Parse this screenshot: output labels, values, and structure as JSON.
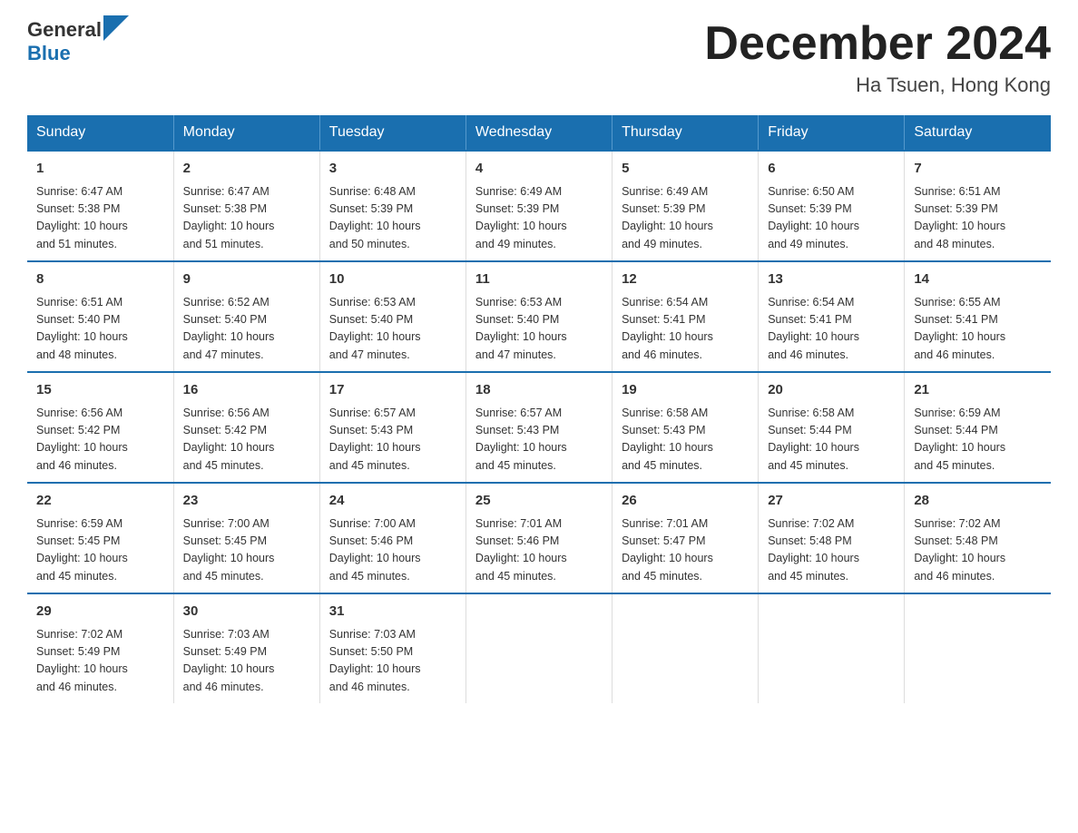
{
  "logo": {
    "general": "General",
    "blue": "Blue"
  },
  "title": "December 2024",
  "location": "Ha Tsuen, Hong Kong",
  "days_of_week": [
    "Sunday",
    "Monday",
    "Tuesday",
    "Wednesday",
    "Thursday",
    "Friday",
    "Saturday"
  ],
  "weeks": [
    [
      {
        "day": "1",
        "sunrise": "6:47 AM",
        "sunset": "5:38 PM",
        "daylight": "10 hours and 51 minutes."
      },
      {
        "day": "2",
        "sunrise": "6:47 AM",
        "sunset": "5:38 PM",
        "daylight": "10 hours and 51 minutes."
      },
      {
        "day": "3",
        "sunrise": "6:48 AM",
        "sunset": "5:39 PM",
        "daylight": "10 hours and 50 minutes."
      },
      {
        "day": "4",
        "sunrise": "6:49 AM",
        "sunset": "5:39 PM",
        "daylight": "10 hours and 49 minutes."
      },
      {
        "day": "5",
        "sunrise": "6:49 AM",
        "sunset": "5:39 PM",
        "daylight": "10 hours and 49 minutes."
      },
      {
        "day": "6",
        "sunrise": "6:50 AM",
        "sunset": "5:39 PM",
        "daylight": "10 hours and 49 minutes."
      },
      {
        "day": "7",
        "sunrise": "6:51 AM",
        "sunset": "5:39 PM",
        "daylight": "10 hours and 48 minutes."
      }
    ],
    [
      {
        "day": "8",
        "sunrise": "6:51 AM",
        "sunset": "5:40 PM",
        "daylight": "10 hours and 48 minutes."
      },
      {
        "day": "9",
        "sunrise": "6:52 AM",
        "sunset": "5:40 PM",
        "daylight": "10 hours and 47 minutes."
      },
      {
        "day": "10",
        "sunrise": "6:53 AM",
        "sunset": "5:40 PM",
        "daylight": "10 hours and 47 minutes."
      },
      {
        "day": "11",
        "sunrise": "6:53 AM",
        "sunset": "5:40 PM",
        "daylight": "10 hours and 47 minutes."
      },
      {
        "day": "12",
        "sunrise": "6:54 AM",
        "sunset": "5:41 PM",
        "daylight": "10 hours and 46 minutes."
      },
      {
        "day": "13",
        "sunrise": "6:54 AM",
        "sunset": "5:41 PM",
        "daylight": "10 hours and 46 minutes."
      },
      {
        "day": "14",
        "sunrise": "6:55 AM",
        "sunset": "5:41 PM",
        "daylight": "10 hours and 46 minutes."
      }
    ],
    [
      {
        "day": "15",
        "sunrise": "6:56 AM",
        "sunset": "5:42 PM",
        "daylight": "10 hours and 46 minutes."
      },
      {
        "day": "16",
        "sunrise": "6:56 AM",
        "sunset": "5:42 PM",
        "daylight": "10 hours and 45 minutes."
      },
      {
        "day": "17",
        "sunrise": "6:57 AM",
        "sunset": "5:43 PM",
        "daylight": "10 hours and 45 minutes."
      },
      {
        "day": "18",
        "sunrise": "6:57 AM",
        "sunset": "5:43 PM",
        "daylight": "10 hours and 45 minutes."
      },
      {
        "day": "19",
        "sunrise": "6:58 AM",
        "sunset": "5:43 PM",
        "daylight": "10 hours and 45 minutes."
      },
      {
        "day": "20",
        "sunrise": "6:58 AM",
        "sunset": "5:44 PM",
        "daylight": "10 hours and 45 minutes."
      },
      {
        "day": "21",
        "sunrise": "6:59 AM",
        "sunset": "5:44 PM",
        "daylight": "10 hours and 45 minutes."
      }
    ],
    [
      {
        "day": "22",
        "sunrise": "6:59 AM",
        "sunset": "5:45 PM",
        "daylight": "10 hours and 45 minutes."
      },
      {
        "day": "23",
        "sunrise": "7:00 AM",
        "sunset": "5:45 PM",
        "daylight": "10 hours and 45 minutes."
      },
      {
        "day": "24",
        "sunrise": "7:00 AM",
        "sunset": "5:46 PM",
        "daylight": "10 hours and 45 minutes."
      },
      {
        "day": "25",
        "sunrise": "7:01 AM",
        "sunset": "5:46 PM",
        "daylight": "10 hours and 45 minutes."
      },
      {
        "day": "26",
        "sunrise": "7:01 AM",
        "sunset": "5:47 PM",
        "daylight": "10 hours and 45 minutes."
      },
      {
        "day": "27",
        "sunrise": "7:02 AM",
        "sunset": "5:48 PM",
        "daylight": "10 hours and 45 minutes."
      },
      {
        "day": "28",
        "sunrise": "7:02 AM",
        "sunset": "5:48 PM",
        "daylight": "10 hours and 46 minutes."
      }
    ],
    [
      {
        "day": "29",
        "sunrise": "7:02 AM",
        "sunset": "5:49 PM",
        "daylight": "10 hours and 46 minutes."
      },
      {
        "day": "30",
        "sunrise": "7:03 AM",
        "sunset": "5:49 PM",
        "daylight": "10 hours and 46 minutes."
      },
      {
        "day": "31",
        "sunrise": "7:03 AM",
        "sunset": "5:50 PM",
        "daylight": "10 hours and 46 minutes."
      },
      null,
      null,
      null,
      null
    ]
  ],
  "labels": {
    "sunrise": "Sunrise:",
    "sunset": "Sunset:",
    "daylight": "Daylight:"
  }
}
